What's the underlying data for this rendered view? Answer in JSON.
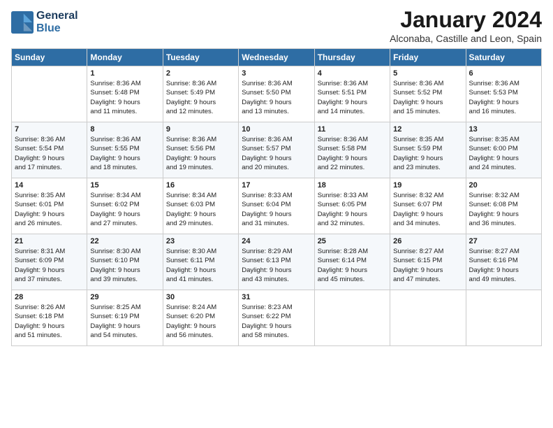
{
  "header": {
    "logo_line1": "General",
    "logo_line2": "Blue",
    "month": "January 2024",
    "location": "Alconaba, Castille and Leon, Spain"
  },
  "weekdays": [
    "Sunday",
    "Monday",
    "Tuesday",
    "Wednesday",
    "Thursday",
    "Friday",
    "Saturday"
  ],
  "weeks": [
    [
      {
        "day": "",
        "text": ""
      },
      {
        "day": "1",
        "text": "Sunrise: 8:36 AM\nSunset: 5:48 PM\nDaylight: 9 hours\nand 11 minutes."
      },
      {
        "day": "2",
        "text": "Sunrise: 8:36 AM\nSunset: 5:49 PM\nDaylight: 9 hours\nand 12 minutes."
      },
      {
        "day": "3",
        "text": "Sunrise: 8:36 AM\nSunset: 5:50 PM\nDaylight: 9 hours\nand 13 minutes."
      },
      {
        "day": "4",
        "text": "Sunrise: 8:36 AM\nSunset: 5:51 PM\nDaylight: 9 hours\nand 14 minutes."
      },
      {
        "day": "5",
        "text": "Sunrise: 8:36 AM\nSunset: 5:52 PM\nDaylight: 9 hours\nand 15 minutes."
      },
      {
        "day": "6",
        "text": "Sunrise: 8:36 AM\nSunset: 5:53 PM\nDaylight: 9 hours\nand 16 minutes."
      }
    ],
    [
      {
        "day": "7",
        "text": "Sunrise: 8:36 AM\nSunset: 5:54 PM\nDaylight: 9 hours\nand 17 minutes."
      },
      {
        "day": "8",
        "text": "Sunrise: 8:36 AM\nSunset: 5:55 PM\nDaylight: 9 hours\nand 18 minutes."
      },
      {
        "day": "9",
        "text": "Sunrise: 8:36 AM\nSunset: 5:56 PM\nDaylight: 9 hours\nand 19 minutes."
      },
      {
        "day": "10",
        "text": "Sunrise: 8:36 AM\nSunset: 5:57 PM\nDaylight: 9 hours\nand 20 minutes."
      },
      {
        "day": "11",
        "text": "Sunrise: 8:36 AM\nSunset: 5:58 PM\nDaylight: 9 hours\nand 22 minutes."
      },
      {
        "day": "12",
        "text": "Sunrise: 8:35 AM\nSunset: 5:59 PM\nDaylight: 9 hours\nand 23 minutes."
      },
      {
        "day": "13",
        "text": "Sunrise: 8:35 AM\nSunset: 6:00 PM\nDaylight: 9 hours\nand 24 minutes."
      }
    ],
    [
      {
        "day": "14",
        "text": "Sunrise: 8:35 AM\nSunset: 6:01 PM\nDaylight: 9 hours\nand 26 minutes."
      },
      {
        "day": "15",
        "text": "Sunrise: 8:34 AM\nSunset: 6:02 PM\nDaylight: 9 hours\nand 27 minutes."
      },
      {
        "day": "16",
        "text": "Sunrise: 8:34 AM\nSunset: 6:03 PM\nDaylight: 9 hours\nand 29 minutes."
      },
      {
        "day": "17",
        "text": "Sunrise: 8:33 AM\nSunset: 6:04 PM\nDaylight: 9 hours\nand 31 minutes."
      },
      {
        "day": "18",
        "text": "Sunrise: 8:33 AM\nSunset: 6:05 PM\nDaylight: 9 hours\nand 32 minutes."
      },
      {
        "day": "19",
        "text": "Sunrise: 8:32 AM\nSunset: 6:07 PM\nDaylight: 9 hours\nand 34 minutes."
      },
      {
        "day": "20",
        "text": "Sunrise: 8:32 AM\nSunset: 6:08 PM\nDaylight: 9 hours\nand 36 minutes."
      }
    ],
    [
      {
        "day": "21",
        "text": "Sunrise: 8:31 AM\nSunset: 6:09 PM\nDaylight: 9 hours\nand 37 minutes."
      },
      {
        "day": "22",
        "text": "Sunrise: 8:30 AM\nSunset: 6:10 PM\nDaylight: 9 hours\nand 39 minutes."
      },
      {
        "day": "23",
        "text": "Sunrise: 8:30 AM\nSunset: 6:11 PM\nDaylight: 9 hours\nand 41 minutes."
      },
      {
        "day": "24",
        "text": "Sunrise: 8:29 AM\nSunset: 6:13 PM\nDaylight: 9 hours\nand 43 minutes."
      },
      {
        "day": "25",
        "text": "Sunrise: 8:28 AM\nSunset: 6:14 PM\nDaylight: 9 hours\nand 45 minutes."
      },
      {
        "day": "26",
        "text": "Sunrise: 8:27 AM\nSunset: 6:15 PM\nDaylight: 9 hours\nand 47 minutes."
      },
      {
        "day": "27",
        "text": "Sunrise: 8:27 AM\nSunset: 6:16 PM\nDaylight: 9 hours\nand 49 minutes."
      }
    ],
    [
      {
        "day": "28",
        "text": "Sunrise: 8:26 AM\nSunset: 6:18 PM\nDaylight: 9 hours\nand 51 minutes."
      },
      {
        "day": "29",
        "text": "Sunrise: 8:25 AM\nSunset: 6:19 PM\nDaylight: 9 hours\nand 54 minutes."
      },
      {
        "day": "30",
        "text": "Sunrise: 8:24 AM\nSunset: 6:20 PM\nDaylight: 9 hours\nand 56 minutes."
      },
      {
        "day": "31",
        "text": "Sunrise: 8:23 AM\nSunset: 6:22 PM\nDaylight: 9 hours\nand 58 minutes."
      },
      {
        "day": "",
        "text": ""
      },
      {
        "day": "",
        "text": ""
      },
      {
        "day": "",
        "text": ""
      }
    ]
  ]
}
